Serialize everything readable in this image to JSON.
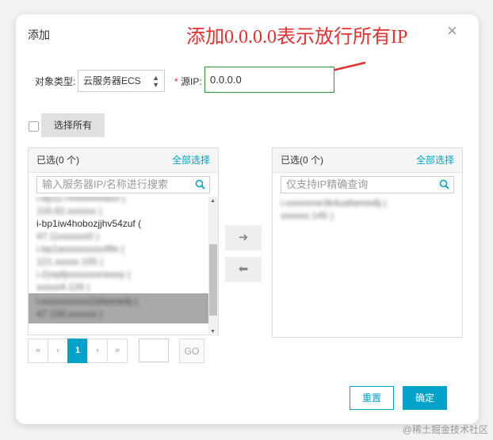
{
  "dialog": {
    "title": "添加",
    "close_icon": "×"
  },
  "annotation": {
    "text": "添加0.0.0.0表示放行所有IP"
  },
  "form": {
    "object_type_label": "对象类型:",
    "object_type_value": "云服务器ECS",
    "required_mark": "*",
    "source_ip_label": "源IP:",
    "source_ip_value": "0.0.0.0",
    "select_all_label": "选择所有"
  },
  "left_panel": {
    "header": "已选(0 个)",
    "select_all": "全部选择",
    "search_placeholder": "输入服务器IP/名称进行搜索",
    "items": [
      {
        "line1": "i-bp117nnnnnn0azo (",
        "line2": "116.62.xxxxxx )"
      },
      {
        "line1": "i-bp1iw4hobozjjhv54zuf (",
        "line2": "47.11xxxxxx0 )"
      },
      {
        "line1": "i-bp1asxxxxxxxxflfe (",
        "line2": "121.xxxxx.105 )"
      },
      {
        "line1": "i-2zej4jxxxxxxxraxwy (",
        "line2": "xxxxx4.126 )"
      },
      {
        "line1": "i-xxxxxxxxxx2afwmie8j (",
        "line2": "47.100.xxxxxx )"
      }
    ]
  },
  "right_panel": {
    "header": "已选(0 个)",
    "select_all": "全部选择",
    "search_placeholder": "仅支持IP精确查询",
    "items": [
      {
        "line1": "i-xxxxxme3k4uafwmie8j (",
        "line2": "xxxxxx.145 )"
      }
    ]
  },
  "transfer": {
    "right_arrow": "➜",
    "left_arrow": "⬅"
  },
  "pager": {
    "first": "«",
    "prev": "‹",
    "current": "1",
    "next": "›",
    "last": "»",
    "go": "GO"
  },
  "footer": {
    "reset": "重置",
    "ok": "确定"
  },
  "watermark": "@稀土掘金技术社区",
  "colors": {
    "accent": "#00a2ca",
    "annotation": "#e5302f",
    "input_border": "#2e9a3e"
  }
}
